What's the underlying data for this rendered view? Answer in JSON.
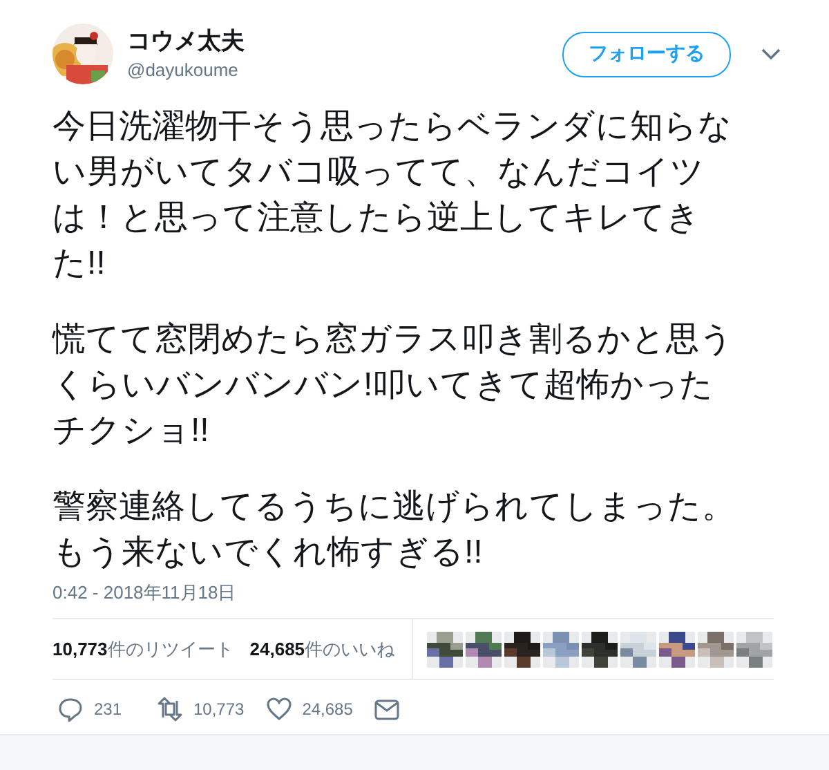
{
  "author": {
    "name": "コウメ太夫",
    "handle": "@dayukoume"
  },
  "follow_button": {
    "label": "フォローする"
  },
  "tweet": {
    "paragraphs": [
      "今日洗濯物干そう思ったらベランダに知らない男がいてタバコ吸ってて、なんだコイツは！と思って注意したら逆上してキレてきた!!",
      "慌てて窓閉めたら窓ガラス叩き割るかと思うくらいバンバンバン!叩いてきて超怖かったチクショ!!",
      "警察連絡してるうちに逃げられてしまった。もう来ないでくれ怖すぎる!!"
    ]
  },
  "timestamp": "0:42 - 2018年11月18日",
  "stats": [
    {
      "count": "10,773",
      "label": "件のリツイート"
    },
    {
      "count": "24,685",
      "label": "件のいいね"
    }
  ],
  "actions": [
    {
      "kind": "reply",
      "count": "231"
    },
    {
      "kind": "retweet",
      "count": "10,773"
    },
    {
      "kind": "like",
      "count": "24,685"
    },
    {
      "kind": "message"
    }
  ]
}
